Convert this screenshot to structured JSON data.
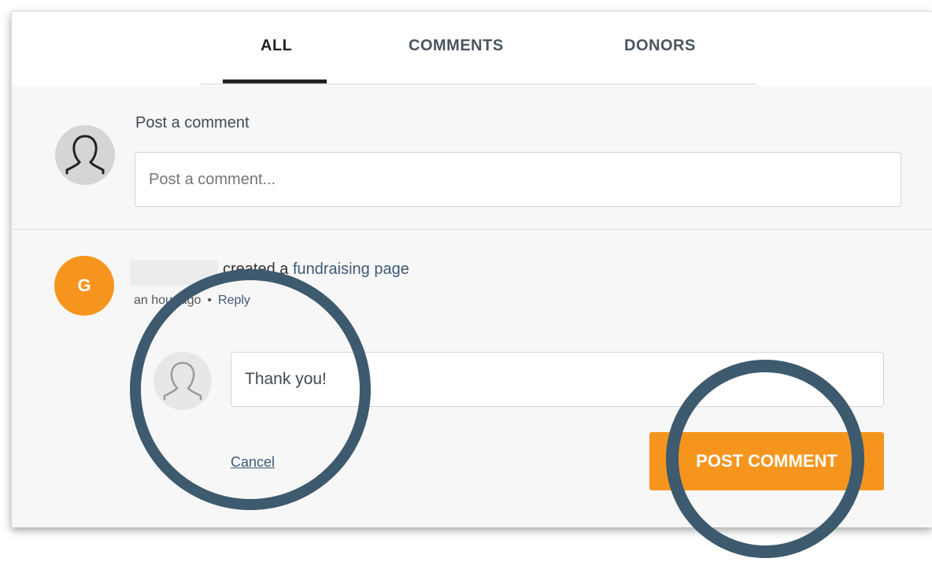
{
  "tabs": [
    {
      "label": "ALL",
      "active": true
    },
    {
      "label": "COMMENTS",
      "active": false
    },
    {
      "label": "DONORS",
      "active": false
    }
  ],
  "composer": {
    "label": "Post a comment",
    "placeholder": "Post a comment..."
  },
  "activity": {
    "avatar_initial": "G",
    "action_text": "created a",
    "link_text": "fundraising page",
    "time_text": "an hour ago",
    "separator": "•",
    "reply_label": "Reply"
  },
  "reply": {
    "value": "Thank you!",
    "cancel_label": "Cancel",
    "submit_label": "POST COMMENT"
  },
  "colors": {
    "accent": "#f6951e",
    "highlight_ring": "#3d5a6e",
    "link": "#3e5a75"
  }
}
